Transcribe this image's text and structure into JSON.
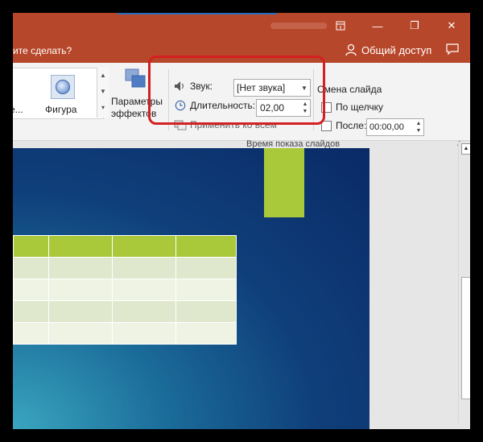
{
  "titlebar": {
    "ribbon_display_icon": "ribbon-display-icon",
    "minimize_symbol": "—",
    "restore_symbol": "❐",
    "close_symbol": "✕",
    "accent_color": "#b7472a"
  },
  "tellme": {
    "text": "ите сделать?",
    "share_label": "Общий доступ"
  },
  "ribbon": {
    "gallery": {
      "item_partial_label": "е...",
      "shape_label": "Фигура"
    },
    "effects_label_line1": "Параметры",
    "effects_label_line2": "эффектов",
    "timing": {
      "sound_label": "Звук:",
      "sound_value": "[Нет звука]",
      "duration_label": "Длительность:",
      "duration_value": "02,00",
      "apply_all_label": "Применить ко всем",
      "advance_title": "Смена слайда",
      "on_click_label": "По щелчку",
      "after_label": "После:",
      "after_value": "00:00,00",
      "group_label": "Время показа слайдов"
    }
  },
  "slide": {
    "accent_green": "#a9c93a",
    "table_rows": 5,
    "table_cols": 4
  }
}
